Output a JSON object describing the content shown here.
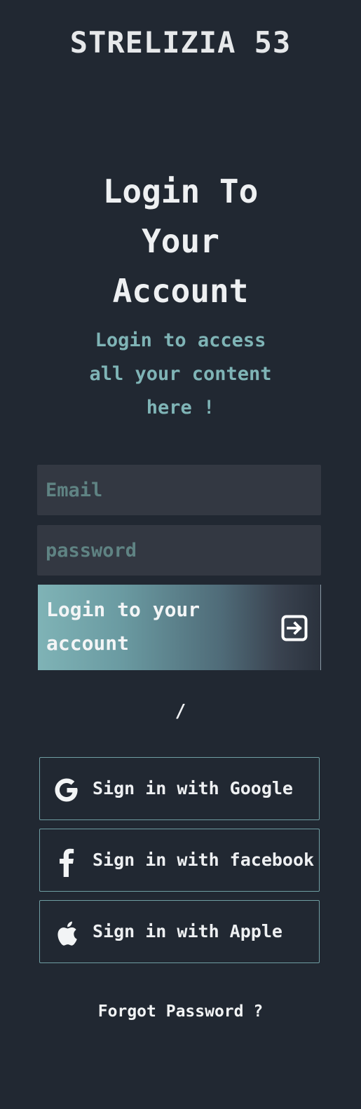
{
  "brand": {
    "name": "STRELIZIA 53"
  },
  "heading": {
    "lines": [
      "Login To",
      "Your",
      "Account"
    ]
  },
  "subheading": {
    "lines": [
      "Login to access",
      "all your content",
      "here !"
    ]
  },
  "form": {
    "email_placeholder": "Email",
    "password_placeholder": "password",
    "email_value": "",
    "password_value": "",
    "submit_label_line1": "Login to your",
    "submit_label_line2": "account",
    "submit_icon": "arrow-right-box-icon"
  },
  "divider": {
    "text": "/"
  },
  "social": {
    "google": {
      "label": "Sign in with Google",
      "icon": "google-icon"
    },
    "facebook": {
      "label": "Sign in with facebook",
      "icon": "facebook-icon"
    },
    "apple": {
      "label": "Sign in with Apple",
      "icon": "apple-icon"
    }
  },
  "forgot": {
    "label": "Forgot Password ?"
  },
  "colors": {
    "background": "#212832",
    "accent": "#7fb4b6",
    "field_bg": "#333842",
    "text": "#eceef0"
  }
}
